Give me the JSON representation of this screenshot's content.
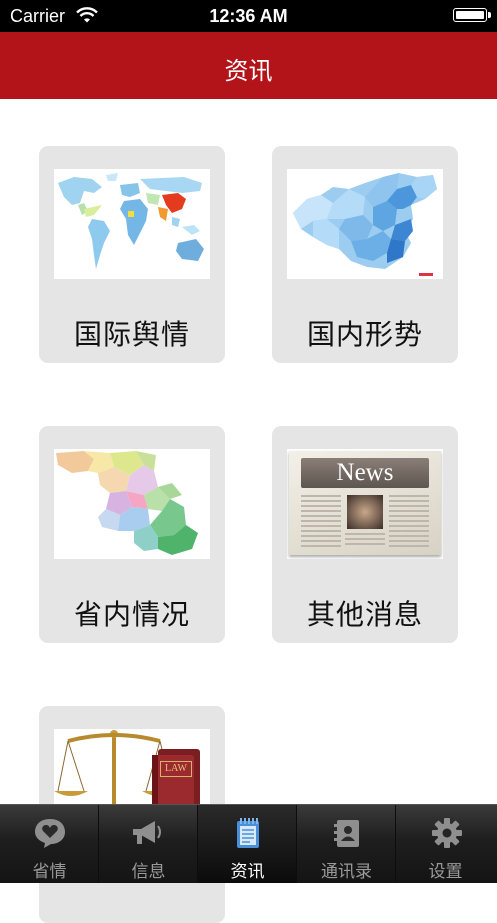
{
  "status": {
    "carrier": "Carrier",
    "time": "12:36 AM"
  },
  "nav": {
    "title": "资讯"
  },
  "tiles": [
    {
      "label": "国际舆情",
      "image": "world-map"
    },
    {
      "label": "国内形势",
      "image": "china-map"
    },
    {
      "label": "省内情况",
      "image": "province-map"
    },
    {
      "label": "其他消息",
      "image": "newspaper",
      "image_text": "News"
    },
    {
      "label": "",
      "image": "law-scales-books",
      "image_text": "LAW"
    }
  ],
  "tabs": [
    {
      "label": "省情",
      "icon": "heart-bubble-icon",
      "active": false
    },
    {
      "label": "信息",
      "icon": "megaphone-icon",
      "active": false
    },
    {
      "label": "资讯",
      "icon": "notepad-icon",
      "active": true
    },
    {
      "label": "通讯录",
      "icon": "contacts-book-icon",
      "active": false
    },
    {
      "label": "设置",
      "icon": "gear-icon",
      "active": false
    }
  ],
  "colors": {
    "nav_red": "#b3141a",
    "tile_bg": "#e5e5e5",
    "tab_active_icon": "#4a90d9"
  }
}
